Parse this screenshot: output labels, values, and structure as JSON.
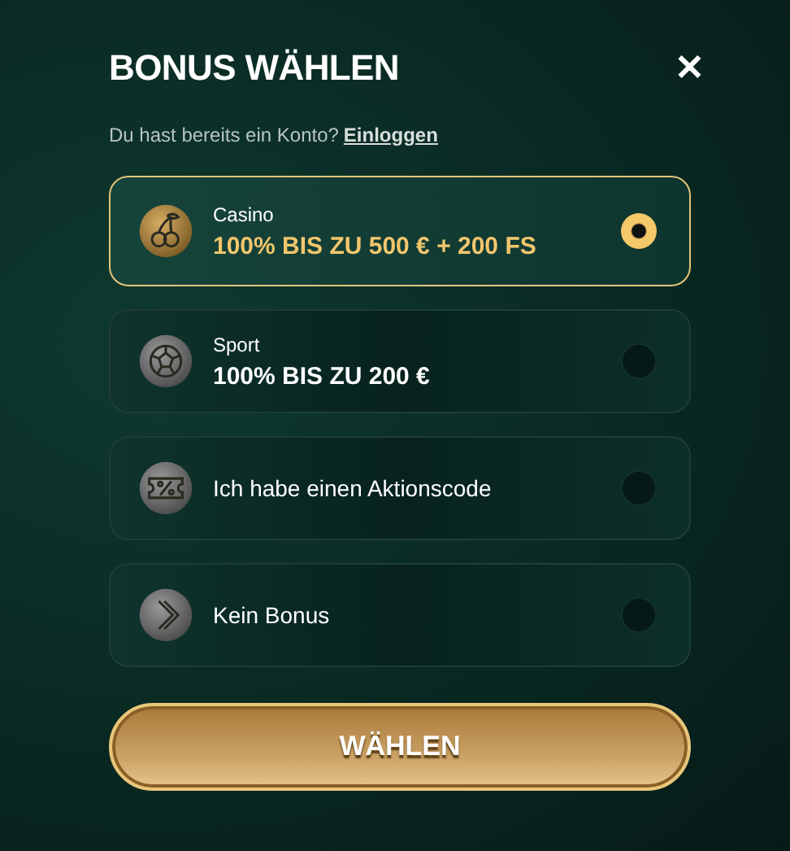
{
  "title": "BONUS WÄHLEN",
  "close": "✕",
  "login_prompt": {
    "text": "Du hast bereits ein Konto?",
    "link": "Einloggen"
  },
  "options": [
    {
      "kind": "casino",
      "label": "Casino",
      "offer": "100% BIS ZU 500 € + 200 FS",
      "selected": true
    },
    {
      "kind": "sport",
      "label": "Sport",
      "offer": "100% BIS ZU 200 €",
      "selected": false
    },
    {
      "kind": "code",
      "label": "Ich habe einen Aktionscode",
      "selected": false
    },
    {
      "kind": "none",
      "label": "Kein Bonus",
      "selected": false
    }
  ],
  "submit": "WÄHLEN"
}
